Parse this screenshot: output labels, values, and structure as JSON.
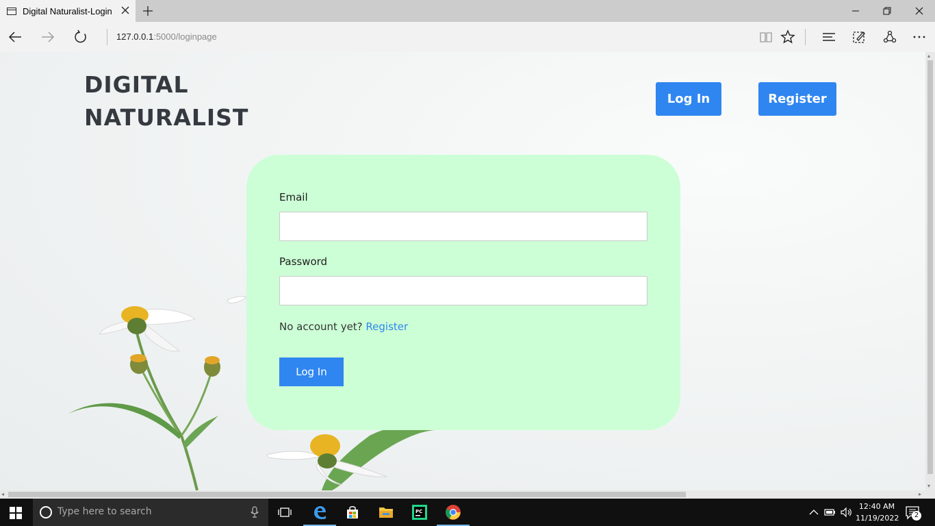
{
  "browser": {
    "tab_title": "Digital Naturalist-Login",
    "url_host": "127.0.0.1",
    "url_path": ":5000/loginpage"
  },
  "page": {
    "brand_line1": "DIGITAL",
    "brand_line2": "NATURALIST",
    "header_login": "Log In",
    "header_register": "Register",
    "form": {
      "email_label": "Email",
      "email_value": "",
      "password_label": "Password",
      "password_value": "",
      "no_account_text": "No account yet?",
      "register_link": "Register",
      "submit_label": "Log In"
    }
  },
  "taskbar": {
    "search_placeholder": "Type here to search",
    "time": "12:40 AM",
    "date": "11/19/2022",
    "notification_count": "2"
  },
  "colors": {
    "accent": "#2f86f0",
    "card": "#ccffd6",
    "brand_text": "#343a40"
  }
}
